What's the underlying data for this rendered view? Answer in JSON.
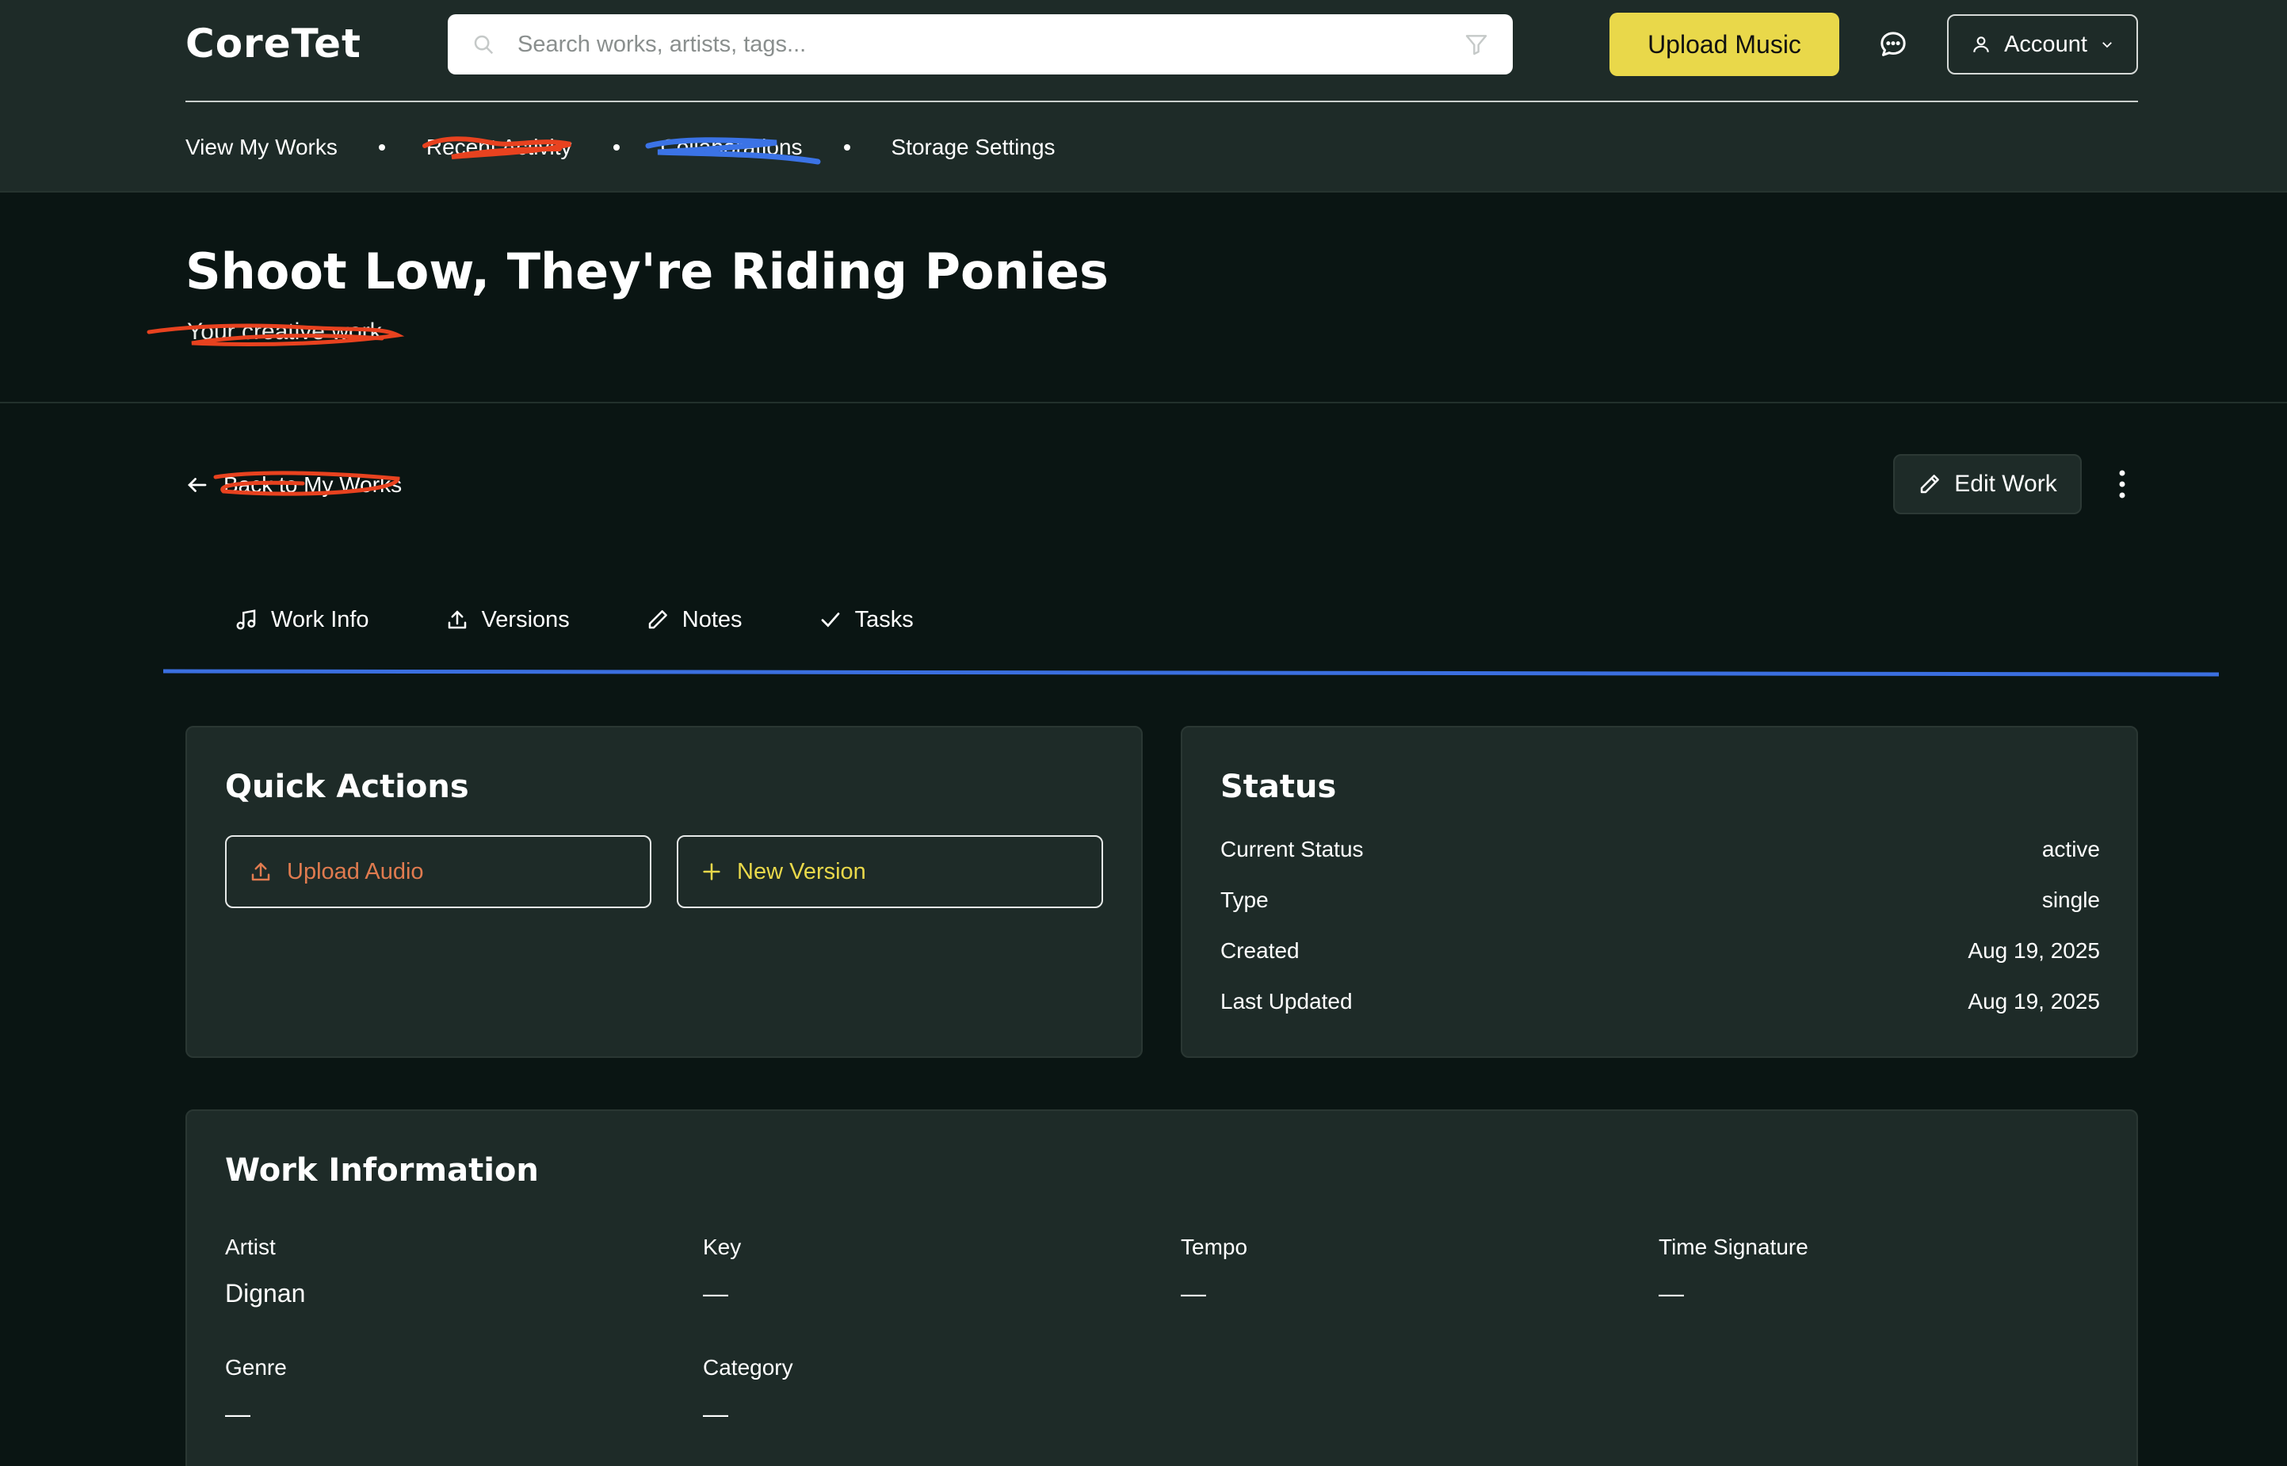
{
  "colors": {
    "header_bg": "#1e2b28",
    "page_bg": "#0a1513",
    "accent_yellow": "#e9d84a",
    "accent_orange": "#e07b4f",
    "tab_underline": "#3b6fe0",
    "scribble_red": "#e8421f",
    "scribble_blue": "#3b73e6"
  },
  "app": {
    "logo": "CoreTet"
  },
  "search": {
    "placeholder": "Search works, artists, tags...",
    "search_icon": "search-icon",
    "filter_icon": "filter-icon"
  },
  "header": {
    "upload_label": "Upload Music",
    "chat_icon": "chat-bubble-icon",
    "account_label": "Account"
  },
  "subnav": {
    "items": [
      {
        "label": "View My Works"
      },
      {
        "label": "Recent Activity",
        "scribbled": true
      },
      {
        "label": "Collaborations",
        "scribbled": true
      },
      {
        "label": "Storage Settings"
      }
    ]
  },
  "page": {
    "title": "Shoot Low, They're Riding Ponies",
    "subtitle": "Your creative work"
  },
  "actions": {
    "back_label": "Back to My Works",
    "edit_label": "Edit Work"
  },
  "tabs": [
    {
      "label": "Work Info",
      "icon": "music-note-icon"
    },
    {
      "label": "Versions",
      "icon": "upload-icon"
    },
    {
      "label": "Notes",
      "icon": "pencil-icon"
    },
    {
      "label": "Tasks",
      "icon": "check-icon"
    }
  ],
  "quick_actions": {
    "title": "Quick Actions",
    "upload_audio": "Upload Audio",
    "new_version": "New Version"
  },
  "status": {
    "title": "Status",
    "rows": [
      {
        "label": "Current Status",
        "value": "active"
      },
      {
        "label": "Type",
        "value": "single"
      },
      {
        "label": "Created",
        "value": "Aug 19, 2025"
      },
      {
        "label": "Last Updated",
        "value": "Aug 19, 2025"
      }
    ]
  },
  "work_info": {
    "title": "Work Information",
    "fields": [
      {
        "label": "Artist",
        "value": "Dignan"
      },
      {
        "label": "Key",
        "value": "—"
      },
      {
        "label": "Tempo",
        "value": "—"
      },
      {
        "label": "Time Signature",
        "value": "—"
      },
      {
        "label": "Genre",
        "value": "—"
      },
      {
        "label": "Category",
        "value": "—"
      }
    ]
  }
}
